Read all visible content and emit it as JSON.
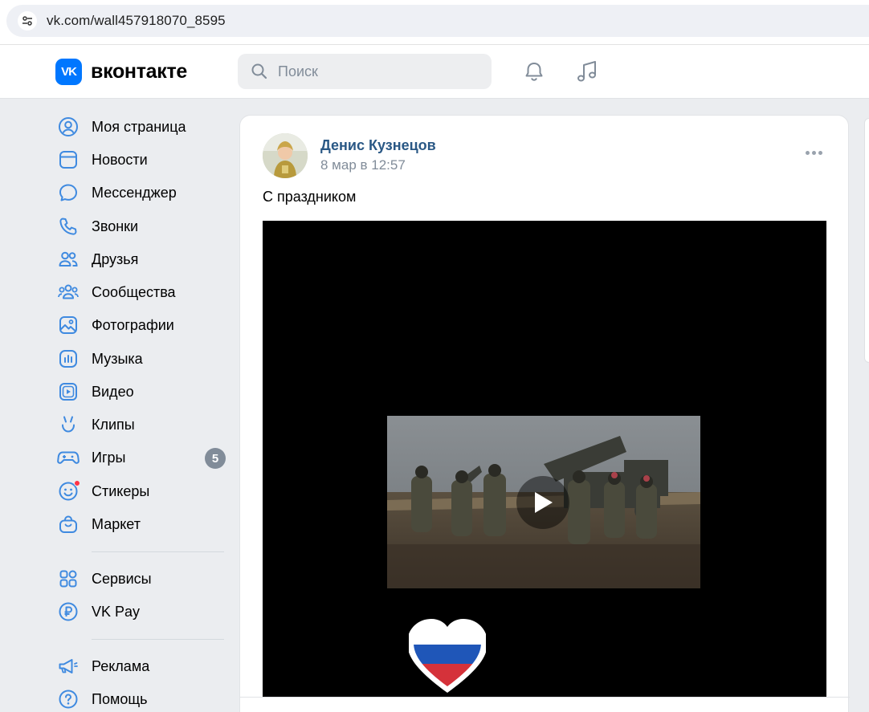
{
  "browser": {
    "url": "vk.com/wall457918070_8595"
  },
  "header": {
    "logo_badge": "VK",
    "logo_text": "вконтакте",
    "search_placeholder": "Поиск"
  },
  "sidebar": {
    "items": [
      {
        "label": "Моя страница",
        "icon": "user-circle-icon"
      },
      {
        "label": "Новости",
        "icon": "news-icon"
      },
      {
        "label": "Мессенджер",
        "icon": "message-bubble-icon"
      },
      {
        "label": "Звонки",
        "icon": "phone-icon"
      },
      {
        "label": "Друзья",
        "icon": "friends-icon"
      },
      {
        "label": "Сообщества",
        "icon": "communities-icon"
      },
      {
        "label": "Фотографии",
        "icon": "photo-icon"
      },
      {
        "label": "Музыка",
        "icon": "music-icon"
      },
      {
        "label": "Видео",
        "icon": "video-icon"
      },
      {
        "label": "Клипы",
        "icon": "clips-icon"
      },
      {
        "label": "Игры",
        "icon": "gamepad-icon",
        "badge": "5"
      },
      {
        "label": "Стикеры",
        "icon": "sticker-icon"
      },
      {
        "label": "Маркет",
        "icon": "market-bag-icon"
      }
    ],
    "secondary": [
      {
        "label": "Сервисы",
        "icon": "services-grid-icon"
      },
      {
        "label": "VK Pay",
        "icon": "ruble-icon"
      }
    ],
    "tertiary": [
      {
        "label": "Реклама",
        "icon": "megaphone-icon"
      },
      {
        "label": "Помощь",
        "icon": "help-icon"
      }
    ]
  },
  "post": {
    "author": "Денис Кузнецов",
    "date": "8 мар в 12:57",
    "text": "С праздником"
  },
  "colors": {
    "accent": "#0077ff",
    "author_link": "#2a5885",
    "muted": "#818c99",
    "page_bg": "#ebedf0"
  }
}
